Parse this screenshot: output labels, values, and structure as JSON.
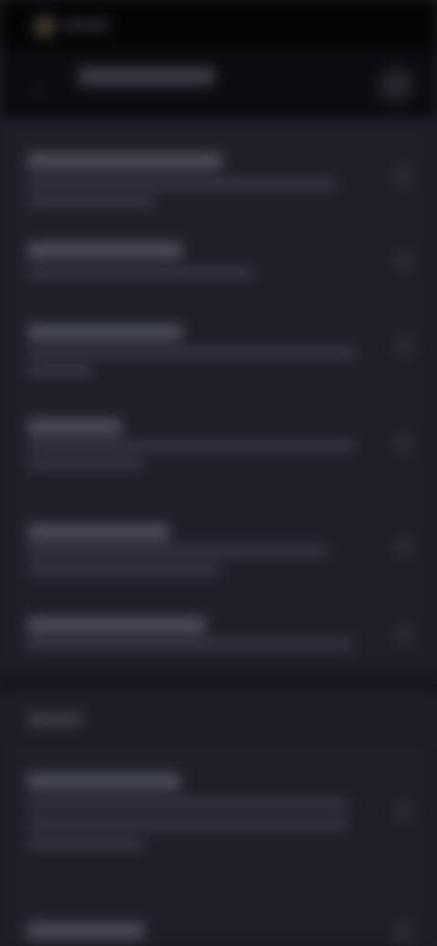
{
  "status_bar": {
    "time": ""
  },
  "app_bar": {
    "title": "",
    "back_icon": "back-arrow-icon",
    "action_icon": "more-icon"
  },
  "section_label": "",
  "colors": {
    "background": "#1d1e27",
    "header": "#0c0d11",
    "text_primary": "#4a4c58",
    "text_secondary": "#353743"
  },
  "items": [
    {
      "title": "",
      "subtitle_1": "",
      "subtitle_2": ""
    },
    {
      "title": "",
      "subtitle_1": ""
    },
    {
      "title": "",
      "subtitle_1": "",
      "subtitle_2": ""
    },
    {
      "title": "",
      "subtitle_1": "",
      "subtitle_2": ""
    },
    {
      "title": "",
      "subtitle_1": "",
      "subtitle_2": ""
    },
    {
      "title": "",
      "subtitle_1": ""
    },
    {
      "title": "",
      "subtitle_1": "",
      "subtitle_2": "",
      "subtitle_3": ""
    },
    {
      "title": ""
    }
  ]
}
